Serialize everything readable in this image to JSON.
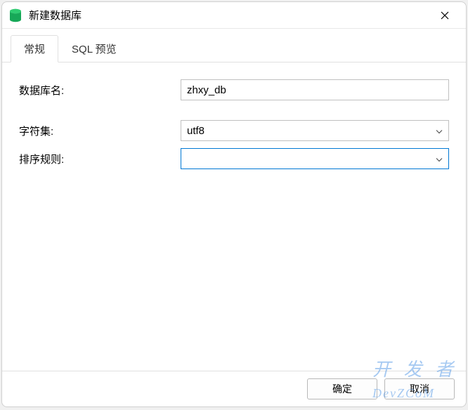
{
  "titlebar": {
    "title": "新建数据库"
  },
  "tabs": {
    "general": "常规",
    "sql_preview": "SQL 预览"
  },
  "form": {
    "db_name_label": "数据库名:",
    "db_name_value": "zhxy_db",
    "charset_label": "字符集:",
    "charset_value": "utf8",
    "collation_label": "排序规则:",
    "collation_value": ""
  },
  "buttons": {
    "ok": "确定",
    "cancel": "取消"
  },
  "watermark": {
    "main": "开 发 者",
    "brand": "DevZCoM"
  }
}
